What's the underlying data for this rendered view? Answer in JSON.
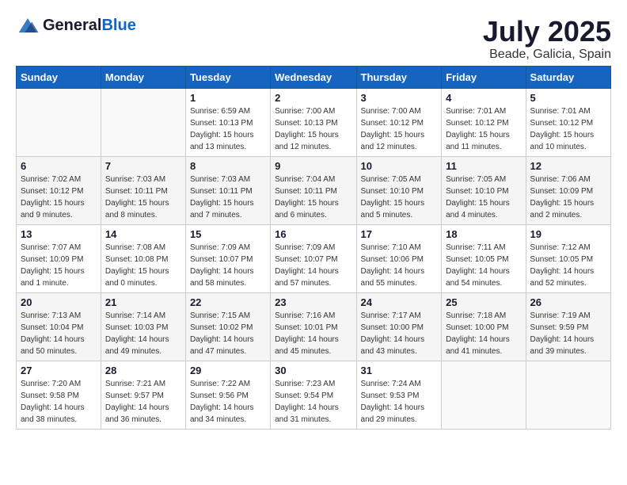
{
  "header": {
    "logo_general": "General",
    "logo_blue": "Blue",
    "month_year": "July 2025",
    "location": "Beade, Galicia, Spain"
  },
  "weekdays": [
    "Sunday",
    "Monday",
    "Tuesday",
    "Wednesday",
    "Thursday",
    "Friday",
    "Saturday"
  ],
  "weeks": [
    [
      {
        "day": "",
        "sunrise": "",
        "sunset": "",
        "daylight": ""
      },
      {
        "day": "",
        "sunrise": "",
        "sunset": "",
        "daylight": ""
      },
      {
        "day": "1",
        "sunrise": "Sunrise: 6:59 AM",
        "sunset": "Sunset: 10:13 PM",
        "daylight": "Daylight: 15 hours and 13 minutes."
      },
      {
        "day": "2",
        "sunrise": "Sunrise: 7:00 AM",
        "sunset": "Sunset: 10:13 PM",
        "daylight": "Daylight: 15 hours and 12 minutes."
      },
      {
        "day": "3",
        "sunrise": "Sunrise: 7:00 AM",
        "sunset": "Sunset: 10:12 PM",
        "daylight": "Daylight: 15 hours and 12 minutes."
      },
      {
        "day": "4",
        "sunrise": "Sunrise: 7:01 AM",
        "sunset": "Sunset: 10:12 PM",
        "daylight": "Daylight: 15 hours and 11 minutes."
      },
      {
        "day": "5",
        "sunrise": "Sunrise: 7:01 AM",
        "sunset": "Sunset: 10:12 PM",
        "daylight": "Daylight: 15 hours and 10 minutes."
      }
    ],
    [
      {
        "day": "6",
        "sunrise": "Sunrise: 7:02 AM",
        "sunset": "Sunset: 10:12 PM",
        "daylight": "Daylight: 15 hours and 9 minutes."
      },
      {
        "day": "7",
        "sunrise": "Sunrise: 7:03 AM",
        "sunset": "Sunset: 10:11 PM",
        "daylight": "Daylight: 15 hours and 8 minutes."
      },
      {
        "day": "8",
        "sunrise": "Sunrise: 7:03 AM",
        "sunset": "Sunset: 10:11 PM",
        "daylight": "Daylight: 15 hours and 7 minutes."
      },
      {
        "day": "9",
        "sunrise": "Sunrise: 7:04 AM",
        "sunset": "Sunset: 10:11 PM",
        "daylight": "Daylight: 15 hours and 6 minutes."
      },
      {
        "day": "10",
        "sunrise": "Sunrise: 7:05 AM",
        "sunset": "Sunset: 10:10 PM",
        "daylight": "Daylight: 15 hours and 5 minutes."
      },
      {
        "day": "11",
        "sunrise": "Sunrise: 7:05 AM",
        "sunset": "Sunset: 10:10 PM",
        "daylight": "Daylight: 15 hours and 4 minutes."
      },
      {
        "day": "12",
        "sunrise": "Sunrise: 7:06 AM",
        "sunset": "Sunset: 10:09 PM",
        "daylight": "Daylight: 15 hours and 2 minutes."
      }
    ],
    [
      {
        "day": "13",
        "sunrise": "Sunrise: 7:07 AM",
        "sunset": "Sunset: 10:09 PM",
        "daylight": "Daylight: 15 hours and 1 minute."
      },
      {
        "day": "14",
        "sunrise": "Sunrise: 7:08 AM",
        "sunset": "Sunset: 10:08 PM",
        "daylight": "Daylight: 15 hours and 0 minutes."
      },
      {
        "day": "15",
        "sunrise": "Sunrise: 7:09 AM",
        "sunset": "Sunset: 10:07 PM",
        "daylight": "Daylight: 14 hours and 58 minutes."
      },
      {
        "day": "16",
        "sunrise": "Sunrise: 7:09 AM",
        "sunset": "Sunset: 10:07 PM",
        "daylight": "Daylight: 14 hours and 57 minutes."
      },
      {
        "day": "17",
        "sunrise": "Sunrise: 7:10 AM",
        "sunset": "Sunset: 10:06 PM",
        "daylight": "Daylight: 14 hours and 55 minutes."
      },
      {
        "day": "18",
        "sunrise": "Sunrise: 7:11 AM",
        "sunset": "Sunset: 10:05 PM",
        "daylight": "Daylight: 14 hours and 54 minutes."
      },
      {
        "day": "19",
        "sunrise": "Sunrise: 7:12 AM",
        "sunset": "Sunset: 10:05 PM",
        "daylight": "Daylight: 14 hours and 52 minutes."
      }
    ],
    [
      {
        "day": "20",
        "sunrise": "Sunrise: 7:13 AM",
        "sunset": "Sunset: 10:04 PM",
        "daylight": "Daylight: 14 hours and 50 minutes."
      },
      {
        "day": "21",
        "sunrise": "Sunrise: 7:14 AM",
        "sunset": "Sunset: 10:03 PM",
        "daylight": "Daylight: 14 hours and 49 minutes."
      },
      {
        "day": "22",
        "sunrise": "Sunrise: 7:15 AM",
        "sunset": "Sunset: 10:02 PM",
        "daylight": "Daylight: 14 hours and 47 minutes."
      },
      {
        "day": "23",
        "sunrise": "Sunrise: 7:16 AM",
        "sunset": "Sunset: 10:01 PM",
        "daylight": "Daylight: 14 hours and 45 minutes."
      },
      {
        "day": "24",
        "sunrise": "Sunrise: 7:17 AM",
        "sunset": "Sunset: 10:00 PM",
        "daylight": "Daylight: 14 hours and 43 minutes."
      },
      {
        "day": "25",
        "sunrise": "Sunrise: 7:18 AM",
        "sunset": "Sunset: 10:00 PM",
        "daylight": "Daylight: 14 hours and 41 minutes."
      },
      {
        "day": "26",
        "sunrise": "Sunrise: 7:19 AM",
        "sunset": "Sunset: 9:59 PM",
        "daylight": "Daylight: 14 hours and 39 minutes."
      }
    ],
    [
      {
        "day": "27",
        "sunrise": "Sunrise: 7:20 AM",
        "sunset": "Sunset: 9:58 PM",
        "daylight": "Daylight: 14 hours and 38 minutes."
      },
      {
        "day": "28",
        "sunrise": "Sunrise: 7:21 AM",
        "sunset": "Sunset: 9:57 PM",
        "daylight": "Daylight: 14 hours and 36 minutes."
      },
      {
        "day": "29",
        "sunrise": "Sunrise: 7:22 AM",
        "sunset": "Sunset: 9:56 PM",
        "daylight": "Daylight: 14 hours and 34 minutes."
      },
      {
        "day": "30",
        "sunrise": "Sunrise: 7:23 AM",
        "sunset": "Sunset: 9:54 PM",
        "daylight": "Daylight: 14 hours and 31 minutes."
      },
      {
        "day": "31",
        "sunrise": "Sunrise: 7:24 AM",
        "sunset": "Sunset: 9:53 PM",
        "daylight": "Daylight: 14 hours and 29 minutes."
      },
      {
        "day": "",
        "sunrise": "",
        "sunset": "",
        "daylight": ""
      },
      {
        "day": "",
        "sunrise": "",
        "sunset": "",
        "daylight": ""
      }
    ]
  ]
}
